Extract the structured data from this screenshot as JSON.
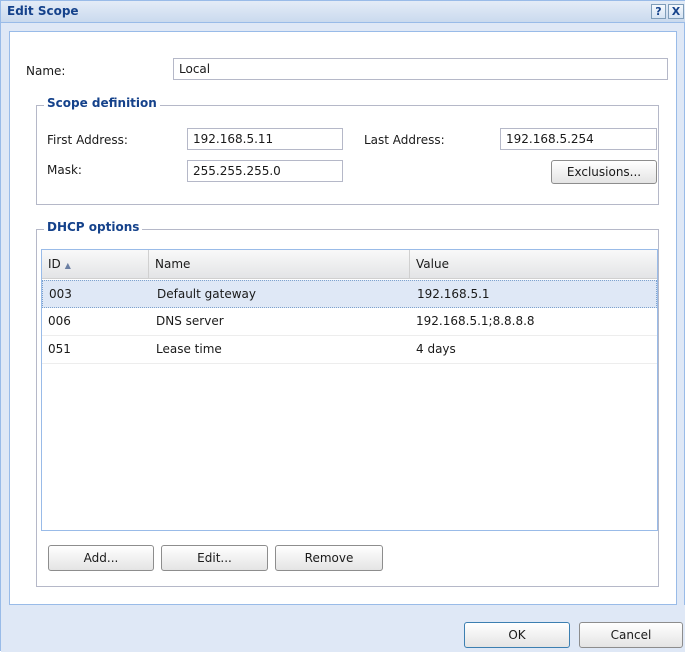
{
  "window": {
    "title": "Edit Scope",
    "help_label": "?",
    "close_label": "X"
  },
  "name_row": {
    "label": "Name:",
    "value": "Local"
  },
  "scope_definition": {
    "legend": "Scope definition",
    "first_address_label": "First Address:",
    "first_address_value": "192.168.5.11",
    "last_address_label": "Last Address:",
    "last_address_value": "192.168.5.254",
    "mask_label": "Mask:",
    "mask_value": "255.255.255.0",
    "exclusions_button": "Exclusions..."
  },
  "dhcp_options": {
    "legend": "DHCP options",
    "columns": {
      "id": "ID",
      "name": "Name",
      "value": "Value"
    },
    "sort_icon": "sort-ascending-icon",
    "rows": [
      {
        "id": "003",
        "name": "Default gateway",
        "value": "192.168.5.1"
      },
      {
        "id": "006",
        "name": "DNS server",
        "value": "192.168.5.1;8.8.8.8"
      },
      {
        "id": "051",
        "name": "Lease time",
        "value": "4 days"
      }
    ],
    "selected_row": 0,
    "add_button": "Add...",
    "edit_button": "Edit...",
    "remove_button": "Remove"
  },
  "footer": {
    "ok_button": "OK",
    "cancel_button": "Cancel"
  },
  "colors": {
    "title": "#15428b",
    "frame": "#dfe8f6",
    "border": "#99bbe8",
    "selected_row": "#dfe8f6"
  }
}
